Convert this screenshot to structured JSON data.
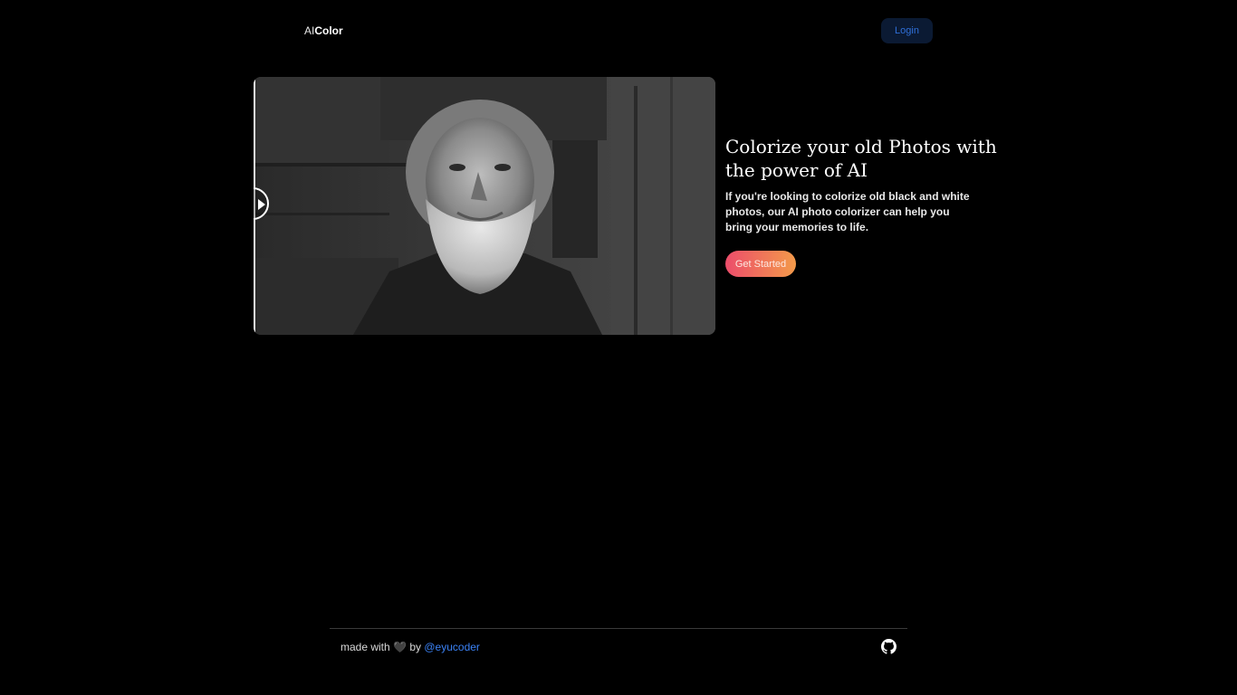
{
  "header": {
    "logo_prefix": "AI",
    "logo_name": "Color",
    "login_label": "Login"
  },
  "hero": {
    "title": "Colorize your old Photos with the power of AI",
    "description": "If you're looking to colorize old black and white photos, our AI photo colorizer can help you bring your memories to life.",
    "cta_label": "Get Started",
    "image_icon": "photo-comparison",
    "handle_icon": "play-triangle-icon"
  },
  "footer": {
    "made_with": "made with",
    "heart": "🖤",
    "by": "by",
    "author_link": "@eyucoder",
    "github_icon": "github-icon"
  },
  "colors": {
    "background": "#000000",
    "login_bg": "#0b1a33",
    "login_text": "#2f6fd8",
    "cta_gradient_start": "#ec4d6b",
    "cta_gradient_end": "#f39a4a",
    "link": "#3b82f6"
  }
}
